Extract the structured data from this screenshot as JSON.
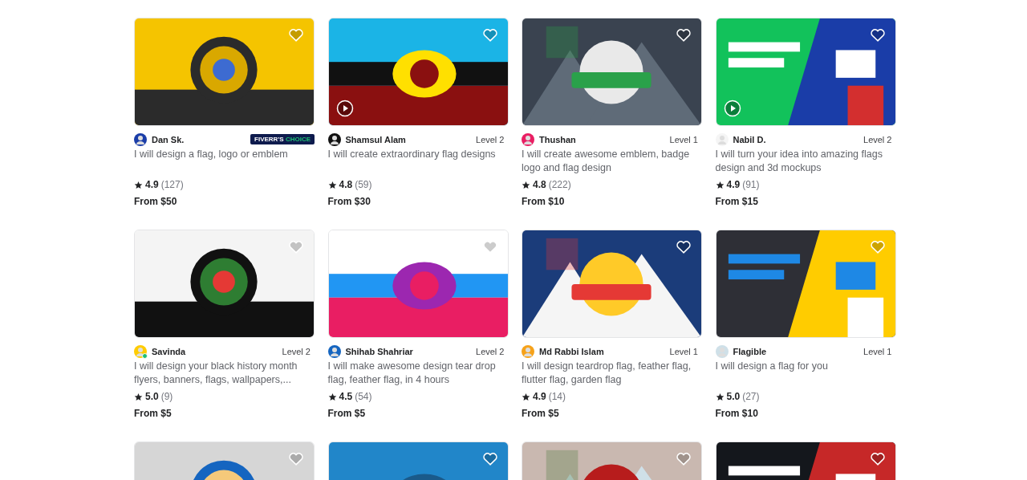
{
  "gigs": [
    {
      "seller": "Dan Sk.",
      "online": false,
      "badge": {
        "brand": "FIVERR'S",
        "label": "CHOICE"
      },
      "title": "I will design a flag, logo or emblem",
      "rating": "4.9",
      "reviews": "(127)",
      "price": "From $50",
      "video": false
    },
    {
      "seller": "Shamsul Alam",
      "online": false,
      "level": "Level 2",
      "title": "I will create extraordinary flag designs",
      "rating": "4.8",
      "reviews": "(59)",
      "price": "From $30",
      "video": true
    },
    {
      "seller": "Thushan",
      "online": false,
      "level": "Level 1",
      "title": "I will create awesome emblem, badge logo and flag design",
      "rating": "4.8",
      "reviews": "(222)",
      "price": "From $10",
      "video": false
    },
    {
      "seller": "Nabil D.",
      "online": false,
      "level": "Level 2",
      "title": "I will turn your idea into amazing flags design and 3d mockups",
      "rating": "4.9",
      "reviews": "(91)",
      "price": "From $15",
      "video": true
    },
    {
      "seller": "Savinda",
      "online": true,
      "level": "Level 2",
      "title": "I will design your black history month flyers, banners, flags, wallpapers,...",
      "rating": "5.0",
      "reviews": "(9)",
      "price": "From $5",
      "video": false
    },
    {
      "seller": "Shihab Shahriar",
      "online": false,
      "level": "Level 2",
      "title": "I will make awesome design tear drop flag, feather flag, in 4 hours",
      "rating": "4.5",
      "reviews": "(54)",
      "price": "From $5",
      "video": false
    },
    {
      "seller": "Md Rabbi Islam",
      "online": false,
      "level": "Level 1",
      "title": "I will design teardrop flag, feather flag, flutter flag, garden flag",
      "rating": "4.9",
      "reviews": "(14)",
      "price": "From $5",
      "video": false
    },
    {
      "seller": "Flagible",
      "online": false,
      "level": "Level 1",
      "title": "I will design a flag for you",
      "rating": "5.0",
      "reviews": "(27)",
      "price": "From $10",
      "video": false
    }
  ]
}
